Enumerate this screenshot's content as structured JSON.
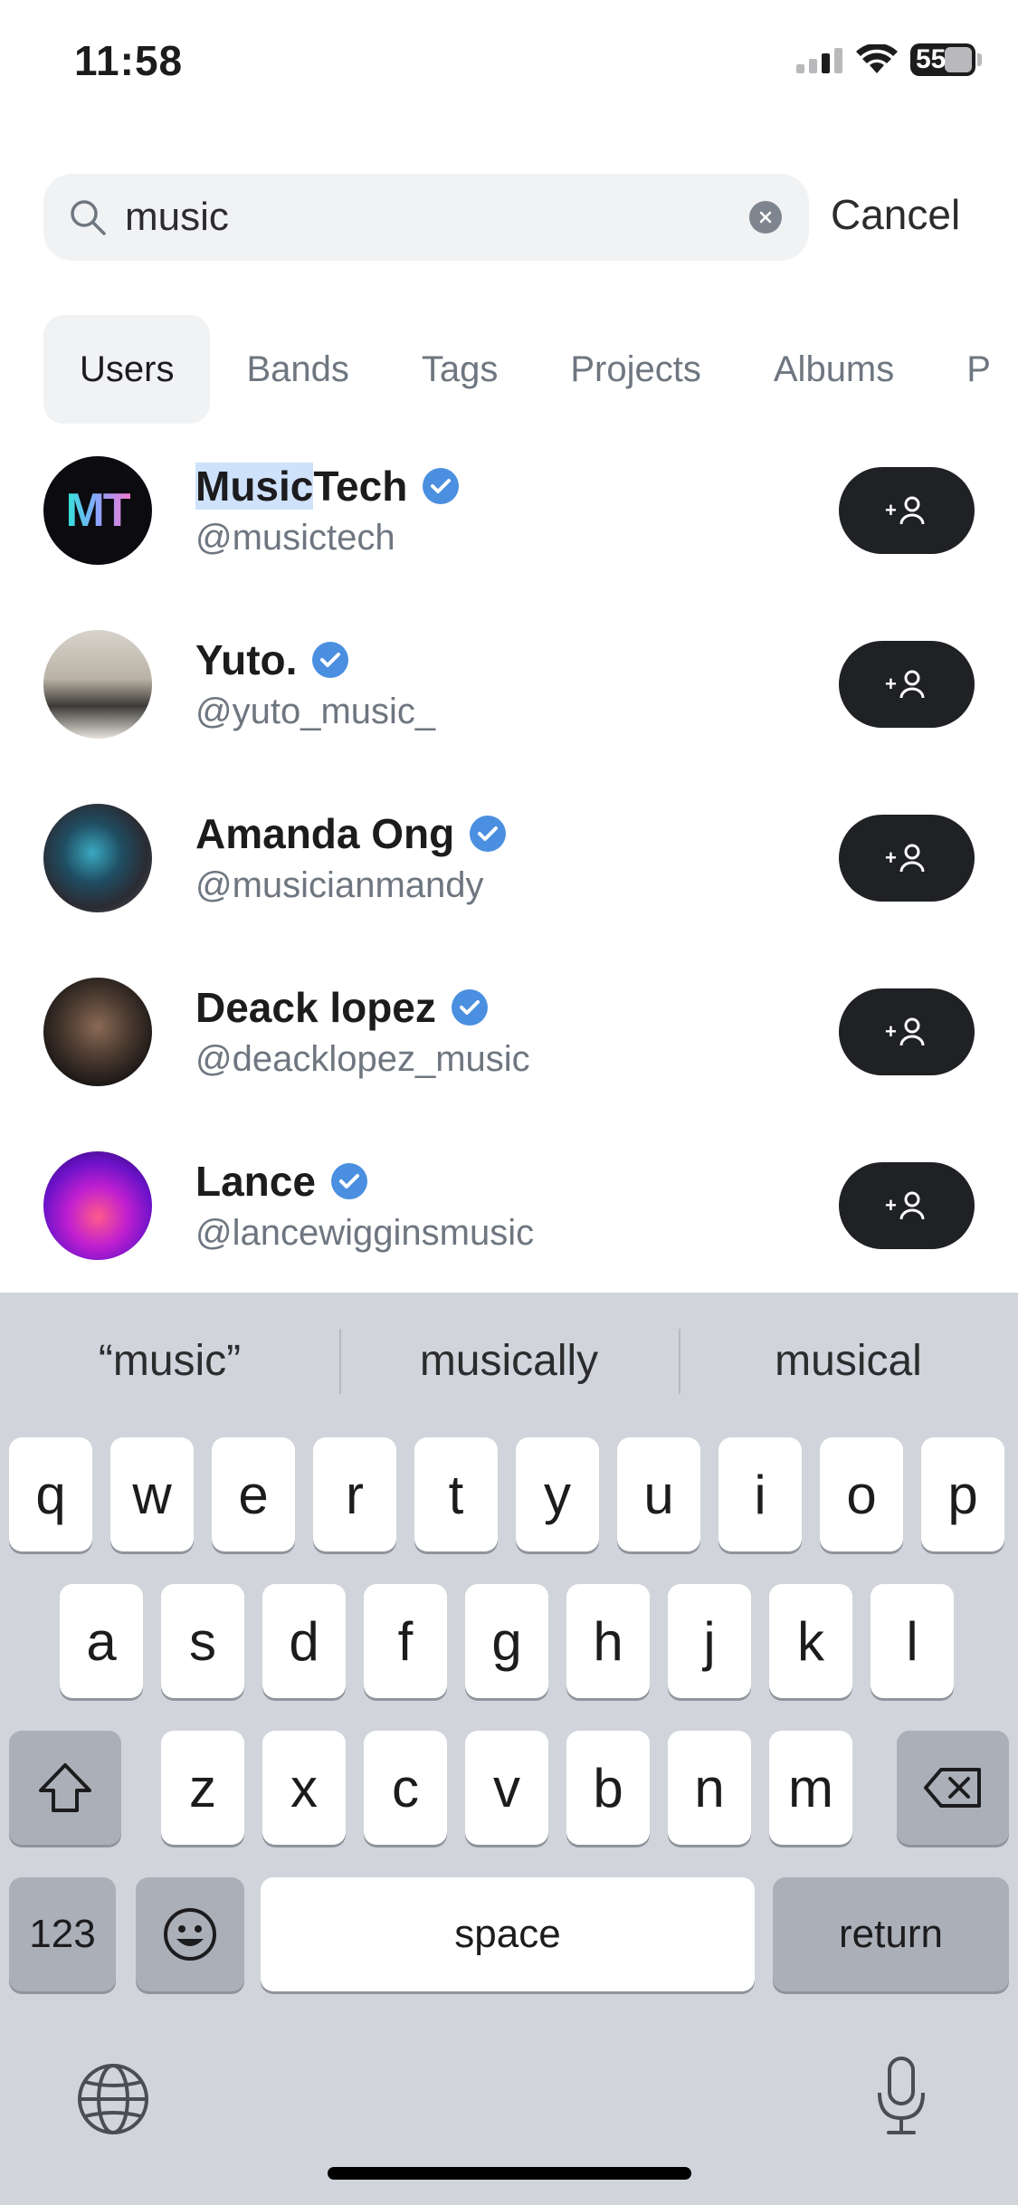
{
  "status_bar": {
    "time": "11:58",
    "battery": "55"
  },
  "search": {
    "value": "music",
    "cancel_label": "Cancel"
  },
  "tabs": [
    "Users",
    "Bands",
    "Tags",
    "Projects",
    "Albums",
    "P"
  ],
  "users": [
    {
      "name_highlight": "Music",
      "name_rest": "Tech",
      "handle": "@musictech"
    },
    {
      "name_highlight": "",
      "name_rest": "Yuto.",
      "handle": "@yuto_music_"
    },
    {
      "name_highlight": "",
      "name_rest": "Amanda Ong",
      "handle": "@musicianmandy"
    },
    {
      "name_highlight": "",
      "name_rest": "Deack lopez",
      "handle": "@deacklopez_music"
    },
    {
      "name_highlight": "",
      "name_rest": "Lance",
      "handle": "@lancewigginsmusic"
    }
  ],
  "avatar_logo_text": "MT",
  "keyboard": {
    "suggestions": [
      "“music”",
      "musically",
      "musical"
    ],
    "row1": [
      "q",
      "w",
      "e",
      "r",
      "t",
      "y",
      "u",
      "i",
      "o",
      "p"
    ],
    "row2": [
      "a",
      "s",
      "d",
      "f",
      "g",
      "h",
      "j",
      "k",
      "l"
    ],
    "row3": [
      "z",
      "x",
      "c",
      "v",
      "b",
      "n",
      "m"
    ],
    "numbers_label": "123",
    "space_label": "space",
    "return_label": "return"
  },
  "colors": {
    "verified": "#4a8fe0",
    "follow_button": "#1f2124",
    "active_tab_bg": "#f1f2f4"
  }
}
